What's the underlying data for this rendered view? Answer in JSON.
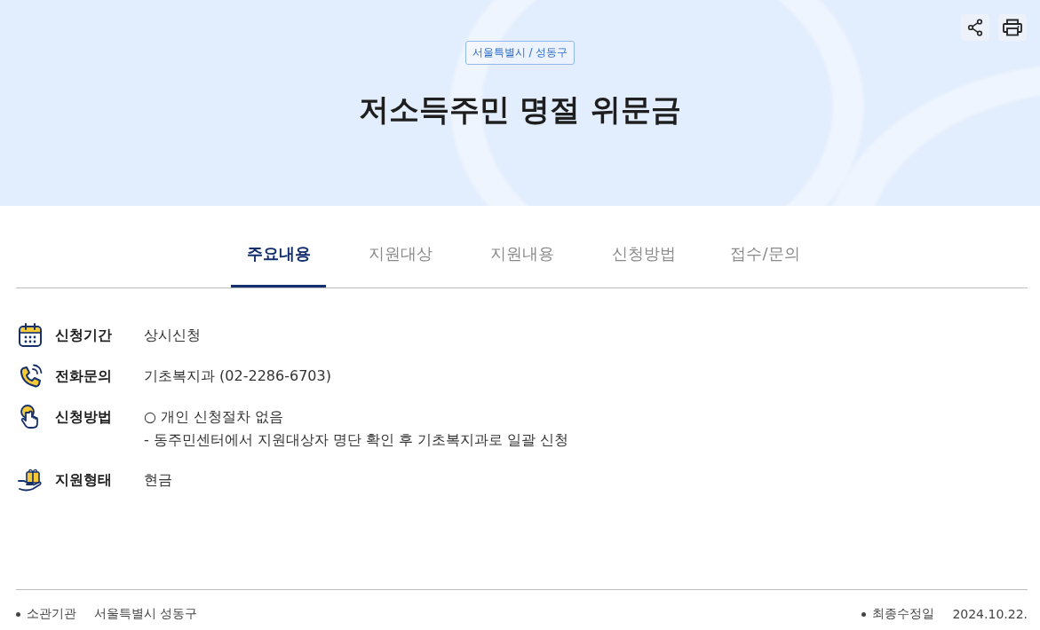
{
  "header": {
    "region_badge": "서울특별시 / 성동구",
    "title": "저소득주민 명절 위문금"
  },
  "tabs": [
    {
      "label": "주요내용",
      "selected": true
    },
    {
      "label": "지원대상",
      "selected": false
    },
    {
      "label": "지원내용",
      "selected": false
    },
    {
      "label": "신청방법",
      "selected": false
    },
    {
      "label": "접수/문의",
      "selected": false
    }
  ],
  "summary": [
    {
      "kind": "calendar",
      "label": "신청기간",
      "lines": [
        "상시신청"
      ]
    },
    {
      "kind": "phone",
      "label": "전화문의",
      "lines": [
        "기초복지과 (02-2286-6703)"
      ]
    },
    {
      "kind": "tap",
      "label": "신청방법",
      "lines": [
        "○ 개인 신청절차 없음",
        "- 동주민센터에서 지원대상자 명단 확인 후 기초복지과로 일괄 신청"
      ]
    },
    {
      "kind": "gift",
      "label": "지원형태",
      "lines": [
        "현금"
      ]
    }
  ],
  "footer": {
    "left": {
      "label": "소관기관",
      "value": "서울특별시 성동구"
    },
    "right": {
      "label": "최종수정일",
      "value": "2024.10.22."
    }
  }
}
